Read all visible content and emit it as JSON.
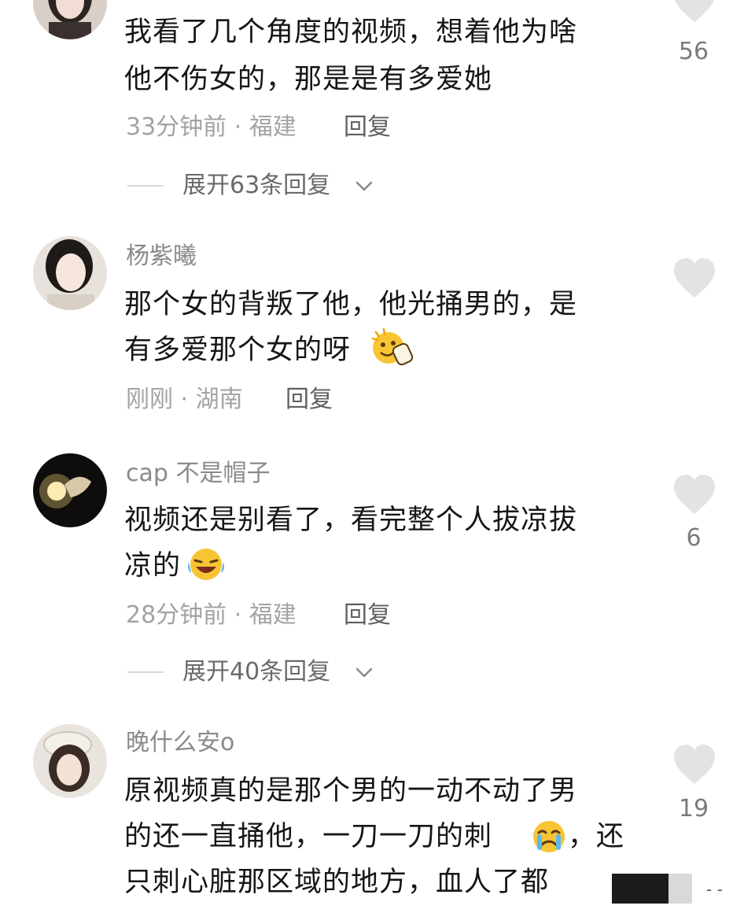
{
  "comments": [
    {
      "username": "",
      "lines": [
        "我看了几个角度的视频，想着他为啥",
        "他不伤女的，那是是有多爱她"
      ],
      "time": "33分钟前 · 福建",
      "reply_label": "回复",
      "likes": "56",
      "expand_label": "展开63条回复",
      "avatar_icon": "avatar-woman-portrait"
    },
    {
      "username": "杨紫曦",
      "lines": [
        "那个女的背叛了他，他光捅男的，是",
        "有多爱那个女的呀"
      ],
      "time": "刚刚 · 湖南",
      "reply_label": "回复",
      "likes": "",
      "emoji": "clapping-emoji",
      "avatar_icon": "avatar-woman-portrait"
    },
    {
      "username": "cap 不是帽子",
      "lines": [
        "视频还是别看了，看完整个人拔凉拔",
        "凉的"
      ],
      "time": "28分钟前 · 福建",
      "reply_label": "回复",
      "likes": "6",
      "expand_label": "展开40条回复",
      "emoji": "laughing-tears-emoji",
      "avatar_icon": "avatar-hand-light"
    },
    {
      "username": "晚什么安o",
      "lines": [
        "原视频真的是那个男的一动不动了男",
        "的还一直捅他，一刀一刀的刺",
        "只刺心脏那区域的地方，血人了都"
      ],
      "line2_suffix": "，还",
      "time": "",
      "likes": "19",
      "emoji": "crying-emoji",
      "avatar_icon": "avatar-girl-hat"
    }
  ],
  "icons": {
    "like": "heart-icon",
    "expand": "chevron-down-icon"
  },
  "colors": {
    "text": "#161616",
    "meta": "#a3a3a3",
    "heart": "#e3e3e3"
  }
}
